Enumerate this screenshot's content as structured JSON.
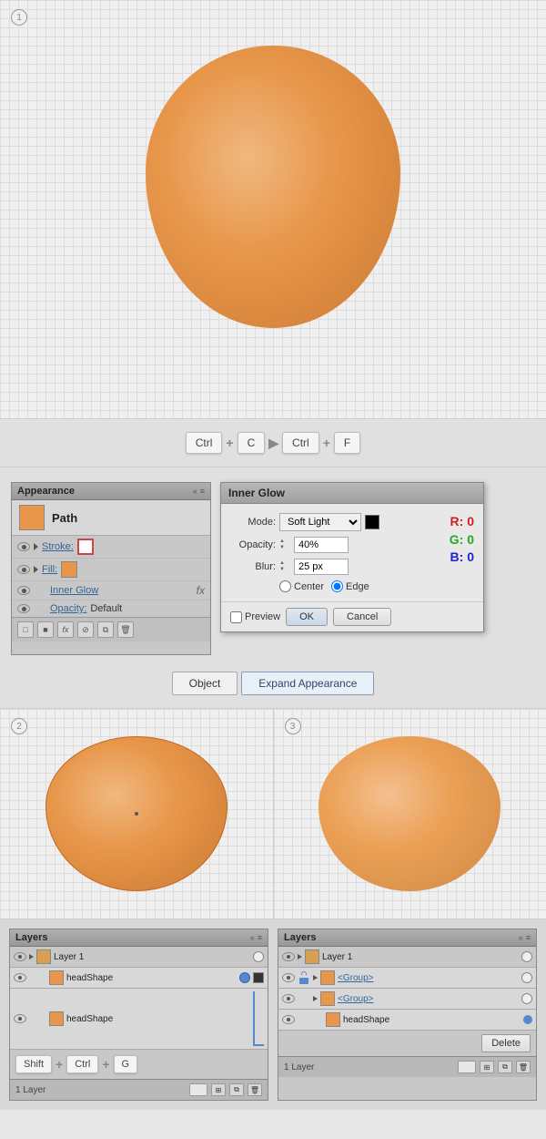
{
  "step1": {
    "number": "1",
    "canvas_bg": "#f0f0f0"
  },
  "shortcuts": {
    "ctrl1": "Ctrl",
    "plus1": "+",
    "c": "C",
    "arrow": "▶",
    "ctrl2": "Ctrl",
    "plus2": "+",
    "f": "F"
  },
  "appearance_panel": {
    "title": "Appearance",
    "path_label": "Path",
    "stroke_label": "Stroke:",
    "fill_label": "Fill:",
    "inner_glow_label": "Inner Glow",
    "opacity_label": "Opacity:",
    "opacity_value": "Default",
    "fx_label": "fx"
  },
  "inner_glow_dialog": {
    "title": "Inner Glow",
    "mode_label": "Mode:",
    "mode_value": "Soft Light",
    "opacity_label": "Opacity:",
    "opacity_value": "40%",
    "blur_label": "Blur:",
    "blur_value": "25 px",
    "center_label": "Center",
    "edge_label": "Edge",
    "preview_label": "Preview",
    "ok_label": "OK",
    "cancel_label": "Cancel",
    "r_label": "R: 0",
    "g_label": "G: 0",
    "b_label": "B: 0"
  },
  "action_buttons": {
    "object_label": "Object",
    "expand_label": "Expand Appearance"
  },
  "step2": {
    "number": "2"
  },
  "step3": {
    "number": "3"
  },
  "layers_left": {
    "title": "Layers",
    "layer1_name": "Layer 1",
    "headShape1": "headShape",
    "headShape2": "headShape",
    "shortcut_shift": "Shift",
    "shortcut_ctrl": "Ctrl",
    "shortcut_g": "G",
    "layer_count": "1 Layer"
  },
  "layers_right": {
    "title": "Layers",
    "layer1_name": "Layer 1",
    "group1": "<Group>",
    "group2": "<Group>",
    "headShape": "headShape",
    "delete_label": "Delete",
    "layer_count": "1 Layer"
  }
}
